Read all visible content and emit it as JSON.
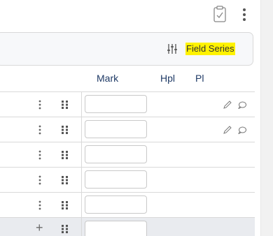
{
  "toolbar": {
    "clipboard_icon": "clipboard-check-icon",
    "menu_icon": "kebab-menu-icon"
  },
  "filter": {
    "icon": "sliders-icon",
    "label": "Field Series",
    "highlight_color": "#fff200"
  },
  "table": {
    "columns": [
      "Mark",
      "Hpl",
      "Pl"
    ],
    "header_color": "#1f3a66",
    "rows": [
      {
        "mark": "",
        "has_edit": true,
        "has_comment": true
      },
      {
        "mark": "",
        "has_edit": true,
        "has_comment": true
      },
      {
        "mark": "",
        "has_edit": false,
        "has_comment": false
      },
      {
        "mark": "",
        "has_edit": false,
        "has_comment": false
      },
      {
        "mark": "",
        "has_edit": false,
        "has_comment": false
      }
    ],
    "add_row": {
      "icon": "plus-icon",
      "label": "+",
      "mark": ""
    }
  }
}
